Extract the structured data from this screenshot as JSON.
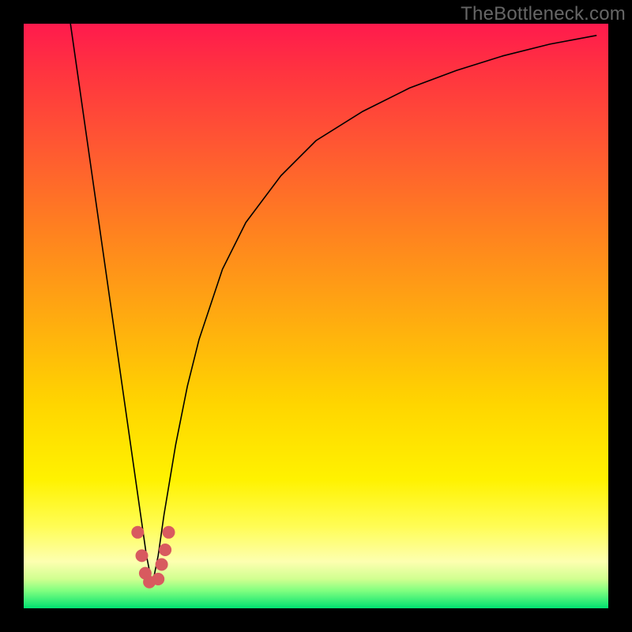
{
  "watermark": {
    "text": "TheBottleneck.com"
  },
  "chart_data": {
    "type": "line",
    "title": "",
    "xlabel": "",
    "ylabel": "",
    "xlim": [
      0,
      100
    ],
    "ylim": [
      0,
      100
    ],
    "gradient_meaning": "vertical red→green, green at bottom = good / less bottleneck",
    "curve_description": "V-shaped absolute-value-like bottleneck curve with minimum near x≈22",
    "series": [
      {
        "name": "bottleneck-curve",
        "x": [
          8,
          10,
          12,
          14,
          16,
          18,
          20,
          21,
          22,
          23,
          24,
          26,
          28,
          30,
          34,
          38,
          44,
          50,
          58,
          66,
          74,
          82,
          90,
          98
        ],
        "y": [
          100,
          86,
          72,
          58,
          44,
          30,
          16,
          9,
          4,
          9,
          16,
          28,
          38,
          46,
          58,
          66,
          74,
          80,
          85,
          89,
          92,
          94.5,
          96.5,
          98
        ]
      }
    ],
    "markers": {
      "name": "highlighted-points",
      "color": "#d85a5f",
      "points": [
        {
          "x": 19.5,
          "y": 13
        },
        {
          "x": 20.2,
          "y": 9
        },
        {
          "x": 20.8,
          "y": 6
        },
        {
          "x": 21.5,
          "y": 4.5
        },
        {
          "x": 23.0,
          "y": 5
        },
        {
          "x": 23.6,
          "y": 7.5
        },
        {
          "x": 24.2,
          "y": 10
        },
        {
          "x": 24.8,
          "y": 13
        }
      ]
    }
  }
}
